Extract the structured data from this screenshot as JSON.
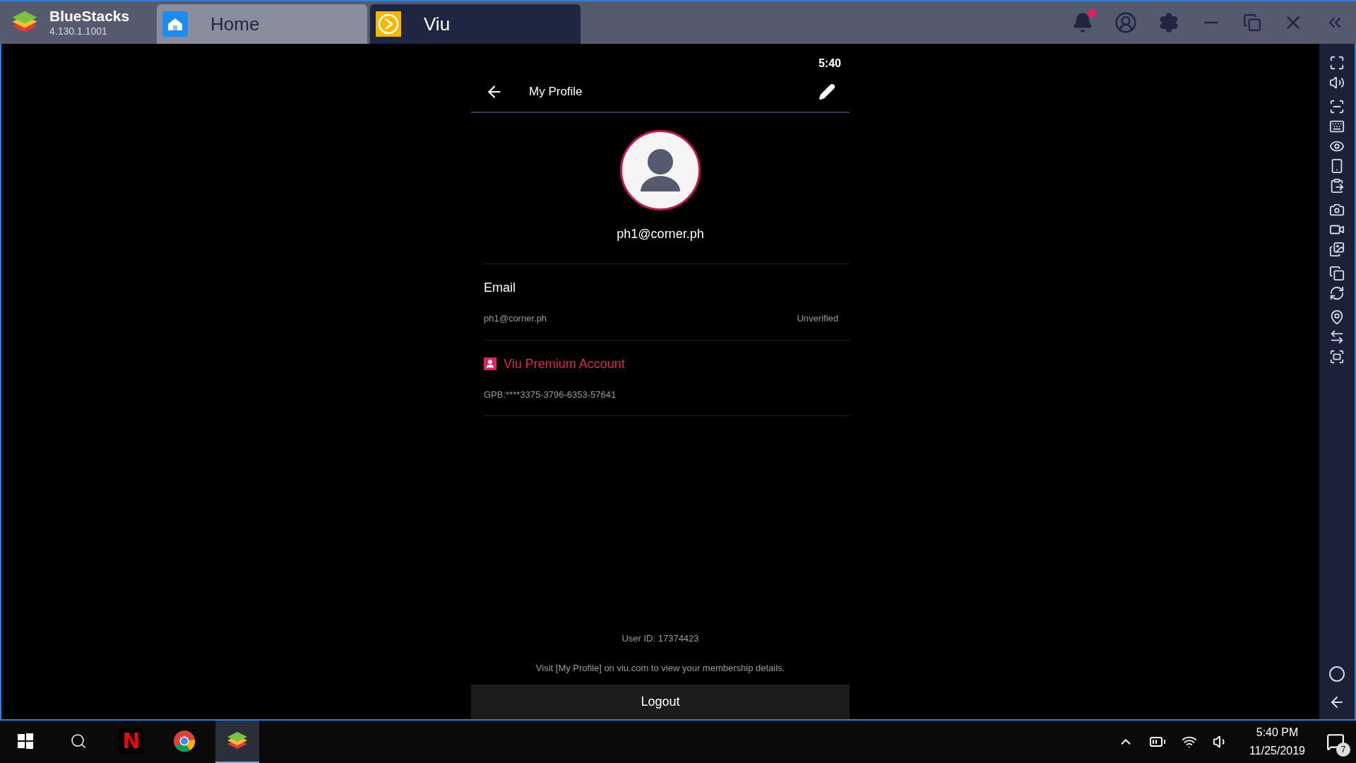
{
  "window": {
    "app_name": "BlueStacks",
    "version": "4.130.1.1001"
  },
  "tabs": [
    {
      "label": "Home",
      "kind": "home",
      "selected": false
    },
    {
      "label": "Viu",
      "kind": "viu",
      "selected": true
    }
  ],
  "notifications": {
    "unread": true
  },
  "phone": {
    "status_time": "5:40",
    "title": "My Profile",
    "username": "ph1@corner.ph",
    "email": {
      "heading": "Email",
      "value": "ph1@corner.ph",
      "status": "Unverified"
    },
    "premium": {
      "title": "Viu Premium Account",
      "code": "GPB:****3375-3796-6353-57641"
    },
    "user_id": "User ID: 17374423",
    "note": "Visit [My Profile] on viu.com to view your membership details.",
    "logout": "Logout"
  },
  "taskbar": {
    "apps": [
      {
        "kind": "start",
        "selected": false
      },
      {
        "kind": "search",
        "selected": false
      },
      {
        "kind": "netflix",
        "label": "N",
        "selected": false
      },
      {
        "kind": "chrome",
        "selected": false
      },
      {
        "kind": "bluestacks",
        "selected": true
      }
    ],
    "time": "5:40 PM",
    "date": "11/25/2019",
    "notification_count": "7"
  }
}
